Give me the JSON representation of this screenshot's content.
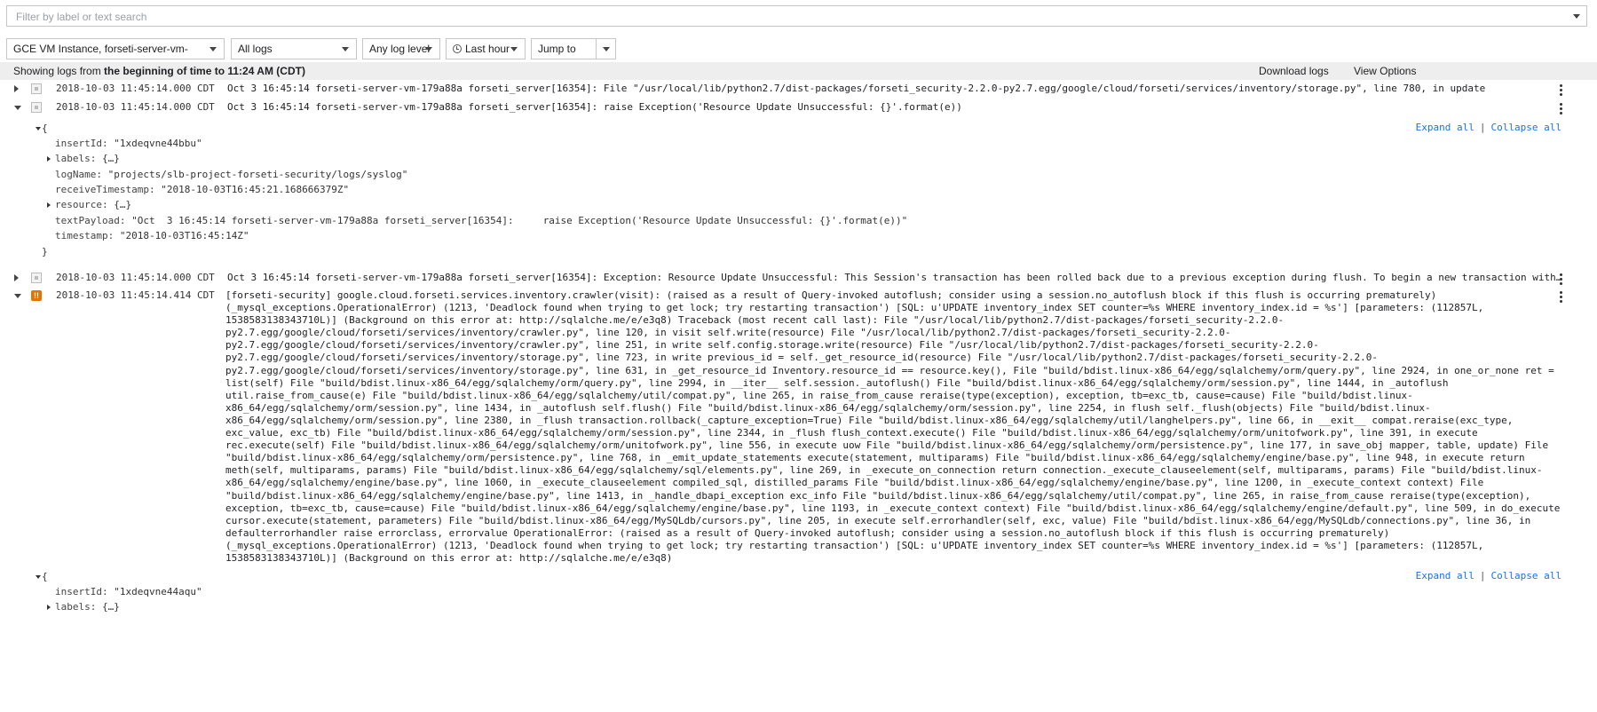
{
  "filter": {
    "placeholder": "Filter by label or text search"
  },
  "controls": {
    "resource": "GCE VM Instance, forseti-server-vm-179a88a",
    "logs": "All logs",
    "level": "Any log level",
    "time": "Last hour",
    "jump": "Jump to now"
  },
  "status": {
    "prefix": "Showing logs from ",
    "range": "the beginning of time to 11:24 AM (CDT)",
    "download": "Download logs",
    "view_options": "View Options"
  },
  "entries": [
    {
      "timestamp": "2018-10-03 11:45:14.000 CDT",
      "text": "Oct 3 16:45:14 forseti-server-vm-179a88a forseti_server[16354]: File \"/usr/local/lib/python2.7/dist-packages/forseti_security-2.2.0-py2.7.egg/google/cloud/forseti/services/inventory/storage.py\", line 780, in update"
    },
    {
      "timestamp": "2018-10-03 11:45:14.000 CDT",
      "text": "Oct 3 16:45:14 forseti-server-vm-179a88a forseti_server[16354]: raise Exception('Resource Update Unsuccessful: {}'.format(e))"
    },
    {
      "timestamp": "2018-10-03 11:45:14.000 CDT",
      "text": "Oct 3 16:45:14 forseti-server-vm-179a88a forseti_server[16354]: Exception: Resource Update Unsuccessful: This Session's transaction has been rolled back due to a previous exception during flush. To begin a new transaction with this Session, first issue Session.rollback()."
    },
    {
      "timestamp": "2018-10-03 11:45:14.414 CDT",
      "severity_label": "!!",
      "text": "[forseti-security] google.cloud.forseti.services.inventory.crawler(visit): (raised as a result of Query-invoked autoflush; consider using a session.no_autoflush block if this flush is occurring prematurely) (_mysql_exceptions.OperationalError) (1213, 'Deadlock found when trying to get lock; try restarting transaction') [SQL: u'UPDATE inventory_index SET counter=%s WHERE inventory_index.id = %s'] [parameters: (112857L, 1538583138343710L)] (Background on this error at: http://sqlalche.me/e/e3q8) Traceback (most recent call last): File \"/usr/local/lib/python2.7/dist-packages/forseti_security-2.2.0-py2.7.egg/google/cloud/forseti/services/inventory/crawler.py\", line 120, in visit self.write(resource) File \"/usr/local/lib/python2.7/dist-packages/forseti_security-2.2.0-py2.7.egg/google/cloud/forseti/services/inventory/crawler.py\", line 251, in write self.config.storage.write(resource) File \"/usr/local/lib/python2.7/dist-packages/forseti_security-2.2.0-py2.7.egg/google/cloud/forseti/services/inventory/storage.py\", line 723, in write previous_id = self._get_resource_id(resource) File \"/usr/local/lib/python2.7/dist-packages/forseti_security-2.2.0-py2.7.egg/google/cloud/forseti/services/inventory/storage.py\", line 631, in _get_resource_id Inventory.resource_id == resource.key(), File \"build/bdist.linux-x86_64/egg/sqlalchemy/orm/query.py\", line 2924, in one_or_none ret = list(self) File \"build/bdist.linux-x86_64/egg/sqlalchemy/orm/query.py\", line 2994, in __iter__ self.session._autoflush() File \"build/bdist.linux-x86_64/egg/sqlalchemy/orm/session.py\", line 1444, in _autoflush util.raise_from_cause(e) File \"build/bdist.linux-x86_64/egg/sqlalchemy/util/compat.py\", line 265, in raise_from_cause reraise(type(exception), exception, tb=exc_tb, cause=cause) File \"build/bdist.linux-x86_64/egg/sqlalchemy/orm/session.py\", line 1434, in _autoflush self.flush() File \"build/bdist.linux-x86_64/egg/sqlalchemy/orm/session.py\", line 2254, in flush self._flush(objects) File \"build/bdist.linux-x86_64/egg/sqlalchemy/orm/session.py\", line 2380, in _flush transaction.rollback(_capture_exception=True) File \"build/bdist.linux-x86_64/egg/sqlalchemy/util/langhelpers.py\", line 66, in __exit__ compat.reraise(exc_type, exc_value, exc_tb) File \"build/bdist.linux-x86_64/egg/sqlalchemy/orm/session.py\", line 2344, in _flush flush_context.execute() File \"build/bdist.linux-x86_64/egg/sqlalchemy/orm/unitofwork.py\", line 391, in execute rec.execute(self) File \"build/bdist.linux-x86_64/egg/sqlalchemy/orm/unitofwork.py\", line 556, in execute uow File \"build/bdist.linux-x86_64/egg/sqlalchemy/orm/persistence.py\", line 177, in save_obj mapper, table, update) File \"build/bdist.linux-x86_64/egg/sqlalchemy/orm/persistence.py\", line 768, in _emit_update_statements execute(statement, multiparams) File \"build/bdist.linux-x86_64/egg/sqlalchemy/engine/base.py\", line 948, in execute return meth(self, multiparams, params) File \"build/bdist.linux-x86_64/egg/sqlalchemy/sql/elements.py\", line 269, in _execute_on_connection return connection._execute_clauseelement(self, multiparams, params) File \"build/bdist.linux-x86_64/egg/sqlalchemy/engine/base.py\", line 1060, in _execute_clauseelement compiled_sql, distilled_params File \"build/bdist.linux-x86_64/egg/sqlalchemy/engine/base.py\", line 1200, in _execute_context context) File \"build/bdist.linux-x86_64/egg/sqlalchemy/engine/base.py\", line 1413, in _handle_dbapi_exception exc_info File \"build/bdist.linux-x86_64/egg/sqlalchemy/util/compat.py\", line 265, in raise_from_cause reraise(type(exception), exception, tb=exc_tb, cause=cause) File \"build/bdist.linux-x86_64/egg/sqlalchemy/engine/base.py\", line 1193, in _execute_context context) File \"build/bdist.linux-x86_64/egg/sqlalchemy/engine/default.py\", line 509, in do_execute cursor.execute(statement, parameters) File \"build/bdist.linux-x86_64/egg/MySQLdb/cursors.py\", line 205, in execute self.errorhandler(self, exc, value) File \"build/bdist.linux-x86_64/egg/MySQLdb/connections.py\", line 36, in defaulterrorhandler raise errorclass, errorvalue OperationalError: (raised as a result of Query-invoked autoflush; consider using a session.no_autoflush block if this flush is occurring prematurely) (_mysql_exceptions.OperationalError) (1213, 'Deadlock found when trying to get lock; try restarting transaction') [SQL: u'UPDATE inventory_index SET counter=%s WHERE inventory_index.id = %s'] [parameters: (112857L, 1538583138343710L)] (Background on this error at: http://sqlalche.me/e/e3q8)"
    }
  ],
  "detail1": {
    "open": "{",
    "close": "}",
    "insertId": "\"1xdeqvne44bbu\"",
    "labels": "{…}",
    "logName": "\"projects/slb-project-forseti-security/logs/syslog\"",
    "receiveTimestamp": "\"2018-10-03T16:45:21.168666379Z\"",
    "resource": "{…}",
    "textPayload": "\"Oct  3 16:45:14 forseti-server-vm-179a88a forseti_server[16354]:     raise Exception('Resource Update Unsuccessful: {}'.format(e))\"",
    "timestamp": "\"2018-10-03T16:45:14Z\""
  },
  "detail2": {
    "open": "{",
    "insertId": "\"1xdeqvne44aqu\"",
    "labels": "{…}"
  },
  "keys": {
    "insertId": "insertId:",
    "labels": "labels:",
    "logName": "logName:",
    "receiveTimestamp": "receiveTimestamp:",
    "resource": "resource:",
    "textPayload": "textPayload:",
    "timestamp": "timestamp:"
  },
  "expander": {
    "expand": "Expand all",
    "separator": "|",
    "collapse": "Collapse all"
  }
}
